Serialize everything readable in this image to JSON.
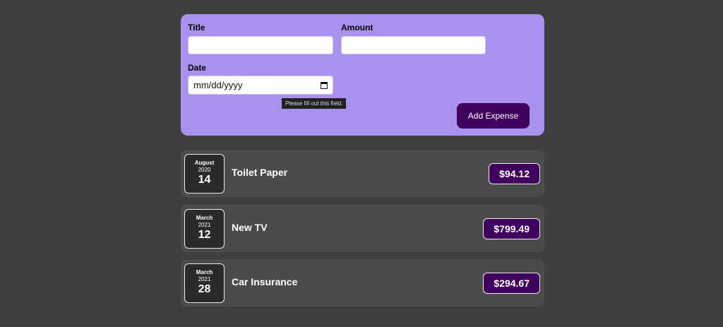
{
  "form": {
    "title_label": "Title",
    "title_value": "",
    "amount_label": "Amount",
    "amount_value": "",
    "date_label": "Date",
    "date_placeholder": "mm/dd/yyyy",
    "validation_tooltip": "Please fill out this field.",
    "submit_label": "Add Expense"
  },
  "expenses": [
    {
      "month": "August",
      "year": "2020",
      "day": "14",
      "title": "Toilet Paper",
      "amount": "$94.12"
    },
    {
      "month": "March",
      "year": "2021",
      "day": "12",
      "title": "New TV",
      "amount": "$799.49"
    },
    {
      "month": "March",
      "year": "2021",
      "day": "28",
      "title": "Car Insurance",
      "amount": "$294.67"
    }
  ],
  "colors": {
    "background": "#3f3f3f",
    "form_background": "#a892ee",
    "accent": "#40005d",
    "item_background": "#4b4b4b"
  }
}
